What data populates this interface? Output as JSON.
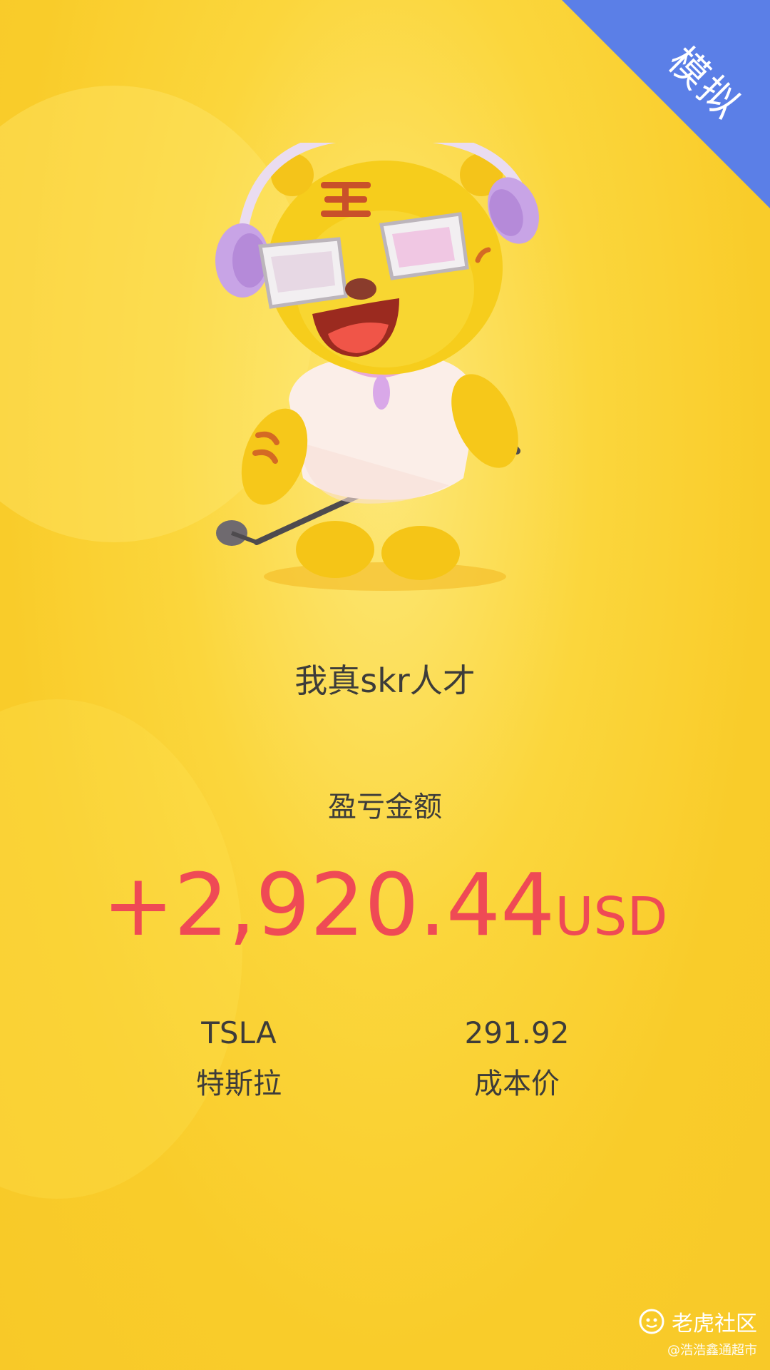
{
  "corner_badge": {
    "label": "模拟",
    "color": "#5b7fe7"
  },
  "mascot": {
    "icon": "tiger-mascot-with-headphones-and-microphone"
  },
  "slogan": "我真skr人才",
  "pnl": {
    "label": "盈亏金额",
    "value": "+2,920.44",
    "currency": "USD",
    "color": "#ef4a55"
  },
  "stock": {
    "symbol": "TSLA",
    "name": "特斯拉"
  },
  "cost": {
    "value": "291.92",
    "label": "成本价"
  },
  "watermark": {
    "brand": "老虎社区",
    "handle": "@浩浩鑫通超市"
  }
}
